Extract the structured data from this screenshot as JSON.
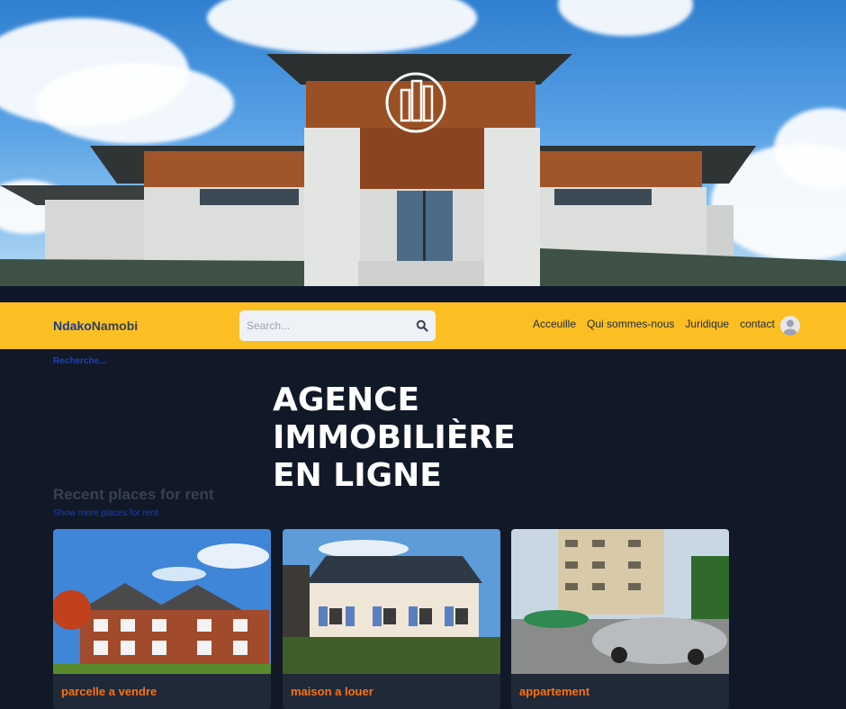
{
  "navbar": {
    "brand_part1": "Ndako",
    "brand_part2": "Namobi",
    "search_placeholder": "Search...",
    "links": [
      "Acceuille",
      "Qui sommes-nous",
      "Juridique",
      "contact"
    ]
  },
  "search_hint": "Recherche...",
  "hero": {
    "headline": [
      "AGENCE",
      "IMMOBILIÈRE",
      "EN LIGNE"
    ]
  },
  "recent": {
    "title": "Recent places for rent",
    "more_link": "Show more places for rent",
    "cards": [
      {
        "title": "parcelle a vendre"
      },
      {
        "title": "maison a louer"
      },
      {
        "title": "appartement"
      }
    ]
  },
  "colors": {
    "navbar": "#fbbf24",
    "background": "#111827",
    "card_title": "#f97316",
    "link": "#1e40af"
  }
}
